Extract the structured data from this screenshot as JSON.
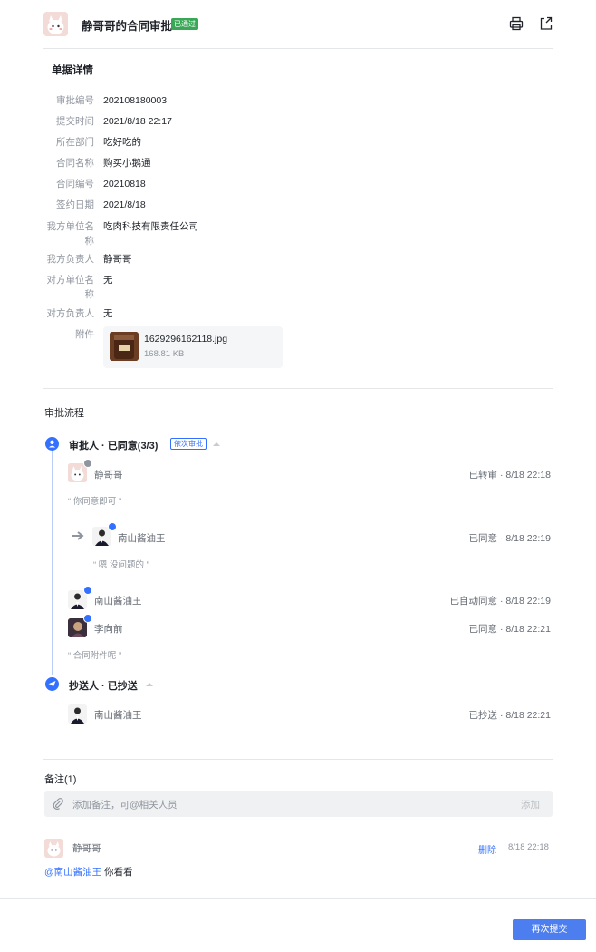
{
  "header": {
    "title": "静哥哥的合同审批",
    "status_badge": "已通过",
    "icons": [
      "print-icon",
      "share-icon"
    ]
  },
  "details": {
    "section_title": "单据详情",
    "fields": [
      {
        "label": "审批编号",
        "value": "202108180003"
      },
      {
        "label": "提交时间",
        "value": "2021/8/18 22:17"
      },
      {
        "label": "所在部门",
        "value": "吃好吃的"
      },
      {
        "label": "合同名称",
        "value": "购买小鹅通"
      },
      {
        "label": "合同编号",
        "value": "20210818"
      },
      {
        "label": "签约日期",
        "value": "2021/8/18"
      },
      {
        "label": "我方单位名称",
        "value": "吃肉科技有限责任公司"
      },
      {
        "label": "我方负责人",
        "value": "静哥哥"
      },
      {
        "label": "对方单位名称",
        "value": "无"
      },
      {
        "label": "对方负责人",
        "value": "无"
      }
    ],
    "attachment": {
      "label": "附件",
      "file_name": "1629296162118.jpg",
      "file_size": "168.81 KB"
    }
  },
  "flow": {
    "section_title": "审批流程",
    "approver_stage": {
      "title": "审批人 · 已同意(3/3)",
      "tag": "依次审批",
      "entries": [
        {
          "name": "静哥哥",
          "status": "已转审 · 8/18 22:18",
          "comment": "“ 你同意即可 ”"
        },
        {
          "name": "南山酱油王",
          "status": "已同意 · 8/18 22:19",
          "comment": "“ 嗯 没问题的 ”"
        },
        {
          "name": "南山酱油王",
          "status": "已自动同意 · 8/18 22:19"
        },
        {
          "name": "李向前",
          "status": "已同意 · 8/18 22:21",
          "comment": "“ 合同附件呢 ”"
        }
      ]
    },
    "cc_stage": {
      "title": "抄送人 · 已抄送",
      "entries": [
        {
          "name": "南山酱油王",
          "status": "已抄送 · 8/18 22:21"
        }
      ]
    }
  },
  "remarks": {
    "title": "备注(1)",
    "placeholder": "添加备注，可@相关人员",
    "add_label": "添加",
    "items": [
      {
        "author": "静哥哥",
        "delete_label": "删除",
        "time": "8/18 22:18",
        "mention": "@南山酱油王",
        "text": " 你看看"
      }
    ]
  },
  "footer": {
    "resubmit_label": "再次提交"
  },
  "colors": {
    "accent": "#3370ff",
    "success": "#3aa757",
    "button": "#4c7ef0"
  }
}
